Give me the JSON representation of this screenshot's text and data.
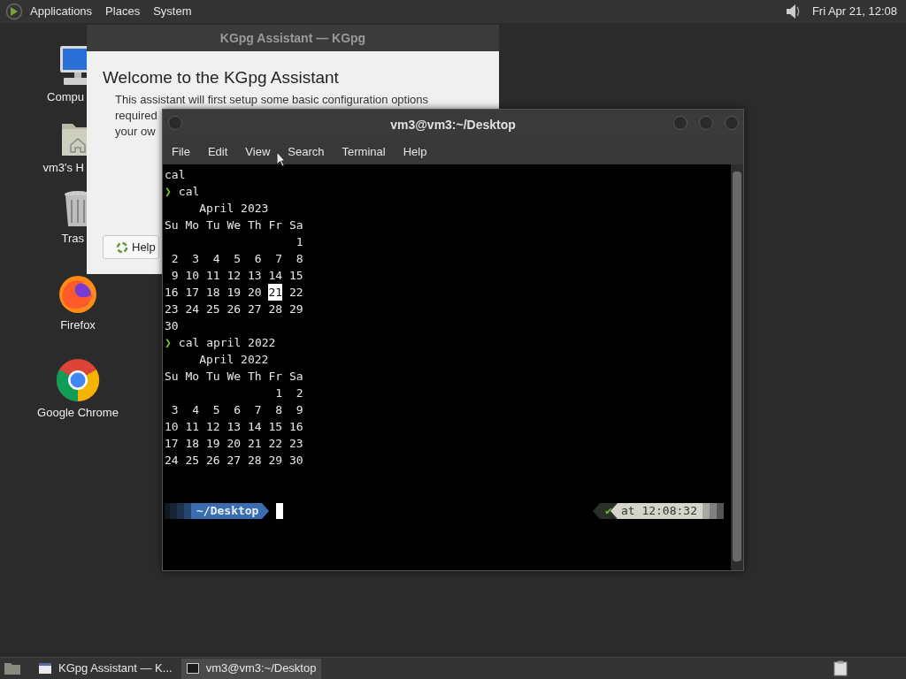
{
  "top_panel": {
    "menus": [
      "Applications",
      "Places",
      "System"
    ],
    "clock": "Fri Apr 21, 12:08"
  },
  "desktop_icons": [
    {
      "label": "Compu",
      "kind": "computer"
    },
    {
      "label": "vm3's H",
      "kind": "home"
    },
    {
      "label": "Tras",
      "kind": "trash"
    },
    {
      "label": "Firefox",
      "kind": "firefox"
    },
    {
      "label": "Google Chrome",
      "kind": "chrome"
    }
  ],
  "kgpg_window": {
    "title": "KGpg Assistant — KGpg",
    "heading": "Welcome to the KGpg Assistant",
    "body_lines": [
      "This assistant will first setup some basic configuration options",
      "required",
      "your ow"
    ],
    "help_button": "Help"
  },
  "terminal": {
    "title": "vm3@vm3:~/Desktop",
    "menus": [
      "File",
      "Edit",
      "View",
      "Search",
      "Terminal",
      "Help"
    ],
    "prompt_symbol": "❯",
    "lines": [
      {
        "kind": "output",
        "text": "cal"
      },
      {
        "kind": "command",
        "text": "cal"
      },
      {
        "kind": "output",
        "text": "     April 2023"
      },
      {
        "kind": "output",
        "text": "Su Mo Tu We Th Fr Sa"
      },
      {
        "kind": "output",
        "text": "                   1"
      },
      {
        "kind": "output",
        "text": " 2  3  4  5  6  7  8"
      },
      {
        "kind": "output",
        "text": " 9 10 11 12 13 14 15"
      },
      {
        "kind": "output",
        "segments": [
          {
            "text": "16 17 18 19 20 ",
            "highlighted": false
          },
          {
            "text": "21",
            "highlighted": true
          },
          {
            "text": " 22",
            "highlighted": false
          }
        ]
      },
      {
        "kind": "output",
        "text": "23 24 25 26 27 28 29"
      },
      {
        "kind": "output",
        "text": "30"
      },
      {
        "kind": "command",
        "text": "cal april 2022"
      },
      {
        "kind": "output",
        "text": "     April 2022"
      },
      {
        "kind": "output",
        "text": "Su Mo Tu We Th Fr Sa"
      },
      {
        "kind": "output",
        "text": "                1  2"
      },
      {
        "kind": "output",
        "text": " 3  4  5  6  7  8  9"
      },
      {
        "kind": "output",
        "text": "10 11 12 13 14 15 16"
      },
      {
        "kind": "output",
        "text": "17 18 19 20 21 22 23"
      },
      {
        "kind": "output",
        "text": "24 25 26 27 28 29 30"
      }
    ],
    "prompt": {
      "path": "~/Desktop",
      "status": "✔",
      "time": "at 12:08:32"
    }
  },
  "taskbar": {
    "tasks": [
      {
        "label": "KGpg Assistant — K...",
        "kind": "window",
        "selected": false
      },
      {
        "label": "vm3@vm3:~/Desktop",
        "kind": "terminal",
        "selected": true
      }
    ]
  }
}
